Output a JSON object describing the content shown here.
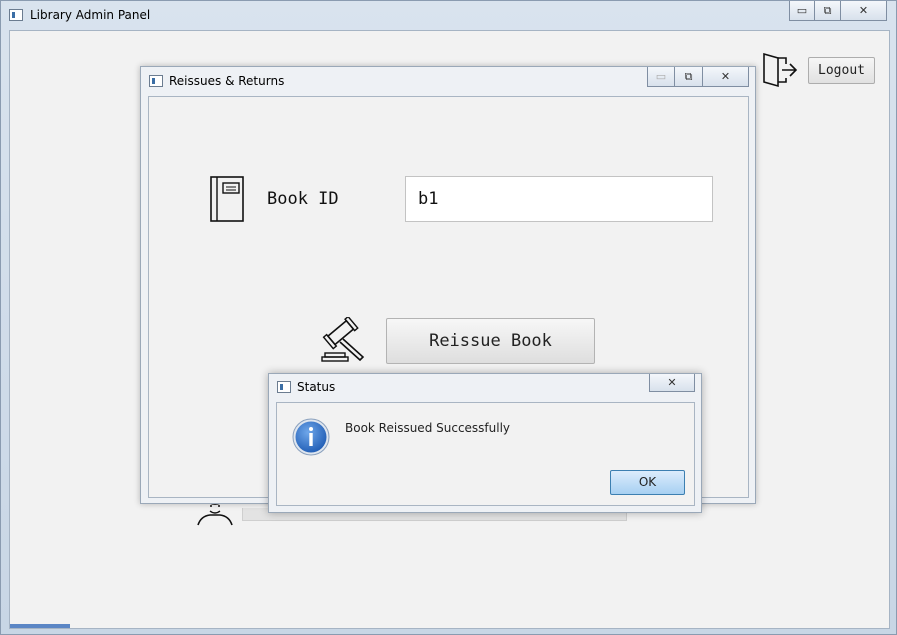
{
  "main_window": {
    "title": "Library Admin Panel",
    "caption": {
      "minimize": "▭",
      "restore": "⧉",
      "close": "✕"
    },
    "logout_label": "Logout",
    "logout_icon": "logout-icon",
    "colors": {
      "accent": "#5b86c5",
      "client_bg": "#f2f2f2"
    }
  },
  "reissue_window": {
    "title": "Reissues & Returns",
    "caption": {
      "minimize": "▭",
      "restore": "⧉",
      "close": "✕"
    },
    "book_icon": "book-icon",
    "book_id_label": "Book ID",
    "book_id_value": "b1",
    "gavel_icon": "gavel-icon",
    "reissue_label": "Reissue Book"
  },
  "status_dialog": {
    "title": "Status",
    "close": "✕",
    "info_icon": "info-icon",
    "message": "Book Reissued Successfully",
    "ok_label": "OK",
    "colors": {
      "info_blue": "#2f6fc4",
      "ok_button": "#a7d0f2"
    }
  }
}
